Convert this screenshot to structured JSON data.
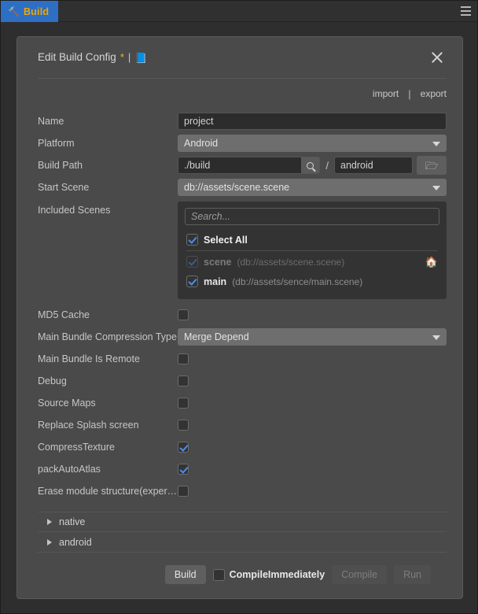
{
  "tabbar": {
    "tab_label": "Build",
    "tab_icon": "hammer-wrench-icon",
    "menu_icon": "hamburger-menu-icon",
    "tab_bg": "#2d6fc4",
    "tab_text_color": "#f0a500"
  },
  "dialog": {
    "title": "Edit Build Config",
    "dirty_marker": "*",
    "separator": "|",
    "doc_icon": "book-icon",
    "close_icon": "close-icon",
    "import_label": "import",
    "io_separator": "|",
    "export_label": "export"
  },
  "form": {
    "name": {
      "label": "Name",
      "value": "project"
    },
    "platform": {
      "label": "Platform",
      "value": "Android"
    },
    "build_path": {
      "label": "Build Path",
      "value": "./build",
      "search_icon": "magnifier-icon",
      "slash": "/",
      "sub_value": "android",
      "folder_icon": "folder-open-icon"
    },
    "start_scene": {
      "label": "Start Scene",
      "value": "db://assets/scene.scene"
    },
    "included_scenes": {
      "label": "Included Scenes",
      "search_placeholder": "Search...",
      "search_value": "",
      "select_all": {
        "label": "Select All",
        "checked": true
      },
      "items": [
        {
          "name": "scene",
          "path": "(db://assets/scene.scene)",
          "checked": true,
          "disabled": true,
          "home_icon": "home-icon"
        },
        {
          "name": "main",
          "path": "(db://assets/sence/main.scene)",
          "checked": true,
          "disabled": false,
          "home_icon": ""
        }
      ]
    },
    "md5_cache": {
      "label": "MD5 Cache",
      "checked": false
    },
    "compression_type": {
      "label": "Main Bundle Compression Type",
      "value": "Merge Depend"
    },
    "bundle_remote": {
      "label": "Main Bundle Is Remote",
      "checked": false
    },
    "debug": {
      "label": "Debug",
      "checked": false
    },
    "source_maps": {
      "label": "Source Maps",
      "checked": false
    },
    "replace_splash": {
      "label": "Replace Splash screen",
      "checked": false
    },
    "compress_texture": {
      "label": "CompressTexture",
      "checked": true
    },
    "pack_auto_atlas": {
      "label": "packAutoAtlas",
      "checked": true
    },
    "erase_module": {
      "label": "Erase module structure(exper…",
      "checked": false
    }
  },
  "foldouts": [
    {
      "label": "native",
      "expanded": false
    },
    {
      "label": "android",
      "expanded": false
    }
  ],
  "footer": {
    "build_label": "Build",
    "compile_immediately": {
      "label": "CompileImmediately",
      "checked": false
    },
    "compile_label": "Compile",
    "compile_disabled": true,
    "run_label": "Run",
    "run_disabled": true
  }
}
